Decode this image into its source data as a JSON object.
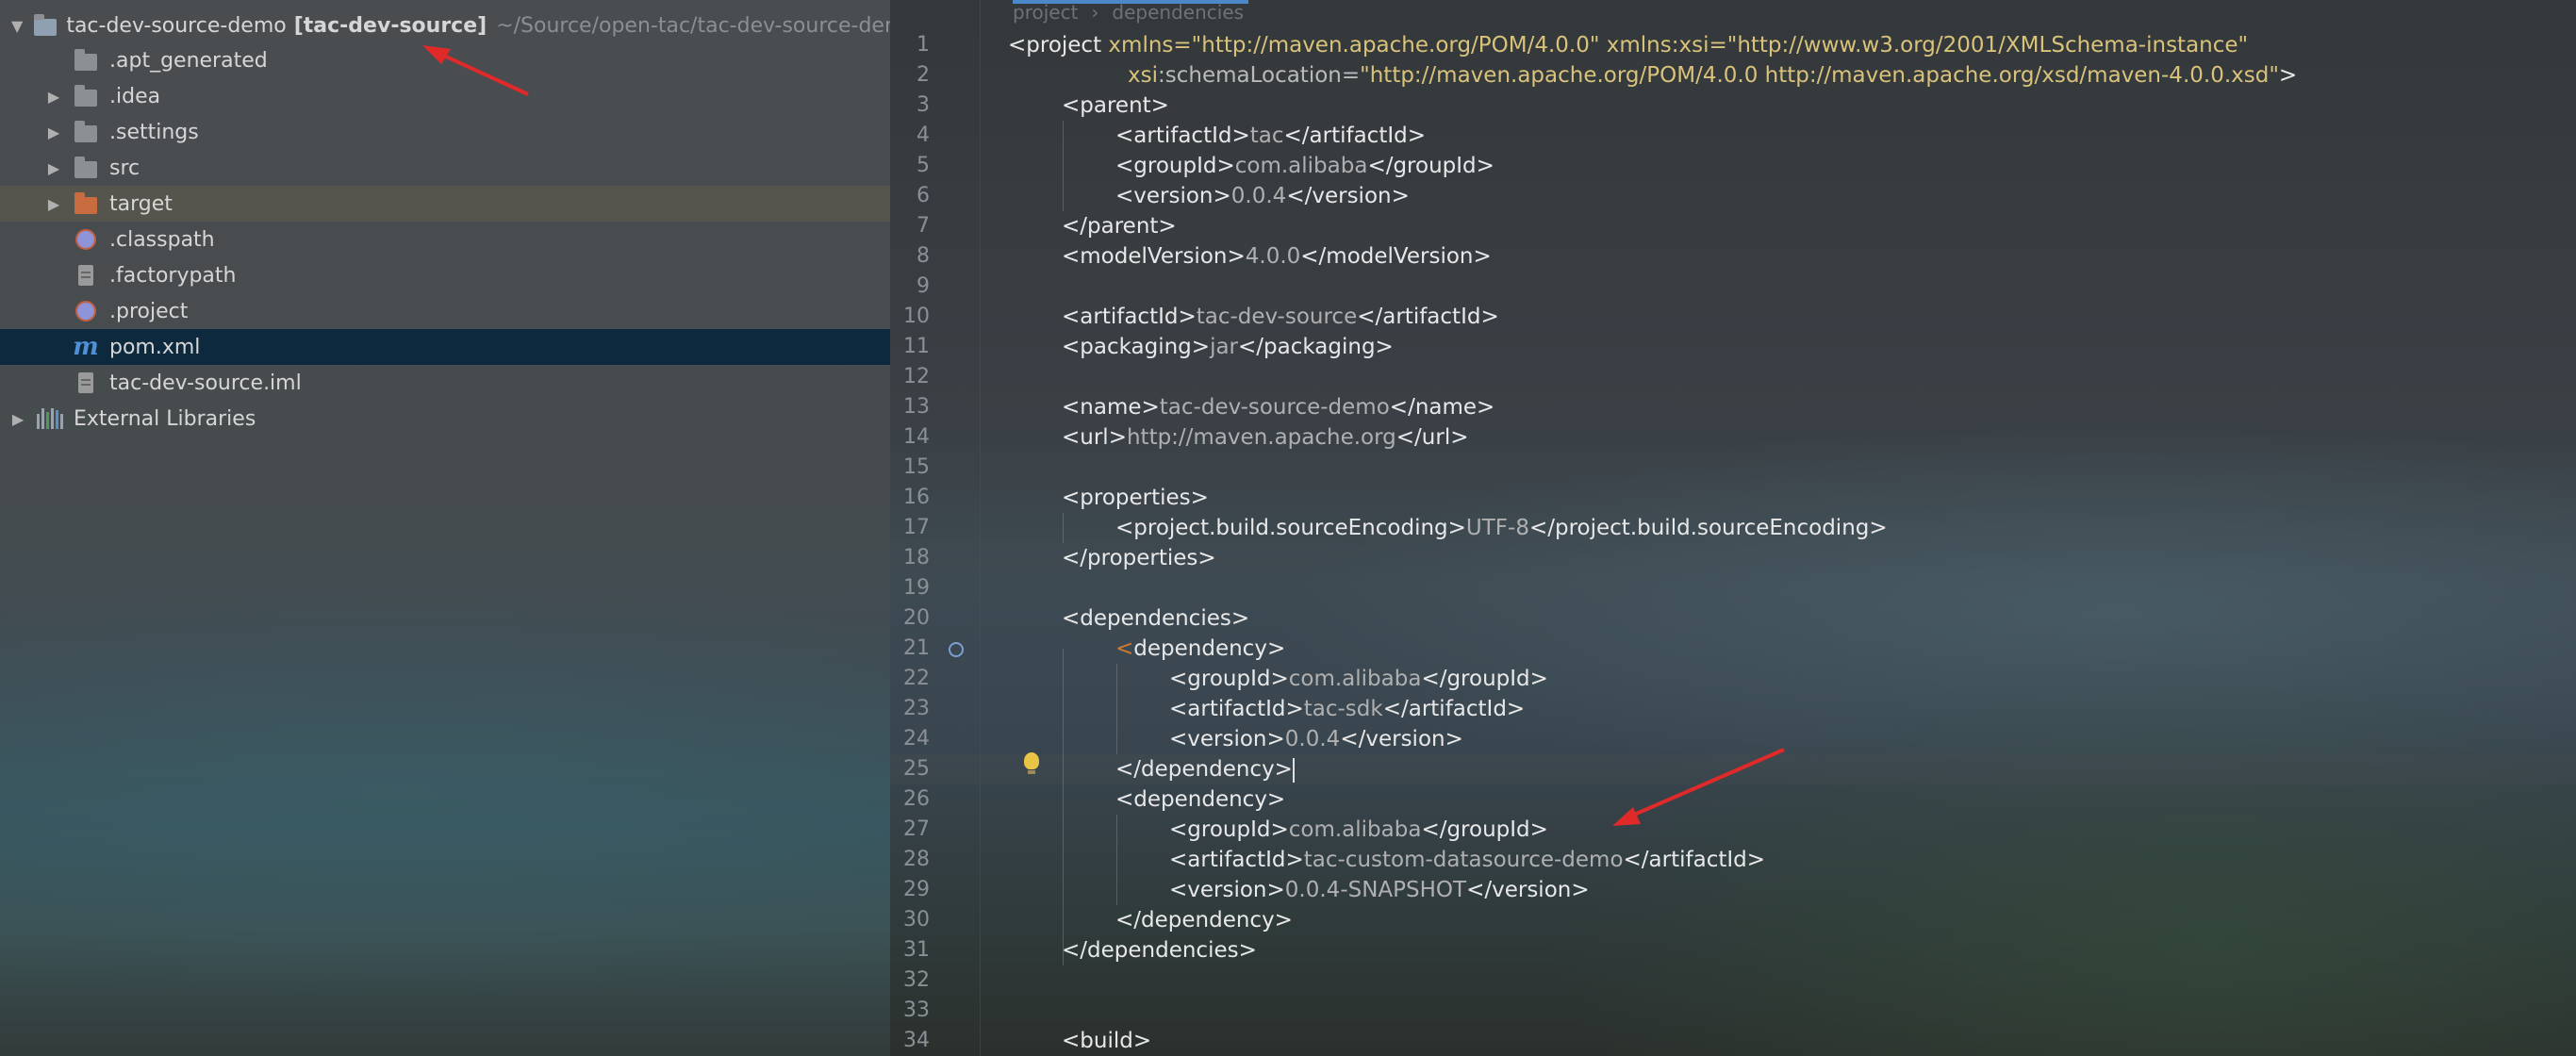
{
  "project_tree": {
    "root": {
      "name": "tac-dev-source-demo",
      "module": "[tac-dev-source]",
      "path": "~/Source/open-tac/tac-dev-source-demo"
    },
    "items": [
      {
        "label": ".apt_generated",
        "icon": "folder-icon"
      },
      {
        "label": ".idea",
        "icon": "folder-icon"
      },
      {
        "label": ".settings",
        "icon": "folder-icon"
      },
      {
        "label": "src",
        "icon": "folder-icon"
      },
      {
        "label": "target",
        "icon": "folder-orange-icon"
      },
      {
        "label": ".classpath",
        "icon": "classpath-icon"
      },
      {
        "label": ".factorypath",
        "icon": "file-icon"
      },
      {
        "label": ".project",
        "icon": "project-file-icon"
      },
      {
        "label": "pom.xml",
        "icon": "maven-icon"
      },
      {
        "label": "tac-dev-source.iml",
        "icon": "iml-file-icon"
      }
    ],
    "external_libraries": "External Libraries"
  },
  "breadcrumb": [
    "project",
    "dependencies"
  ],
  "editor": {
    "line_numbers": [
      "1",
      "2",
      "3",
      "4",
      "5",
      "6",
      "7",
      "8",
      "9",
      "10",
      "11",
      "12",
      "13",
      "14",
      "15",
      "16",
      "17",
      "18",
      "19",
      "20",
      "21",
      "22",
      "23",
      "24",
      "25",
      "26",
      "27",
      "28",
      "29",
      "30",
      "31",
      "32",
      "33",
      "34"
    ],
    "lines": {
      "l1_a": "<project ",
      "l1_b": "xmlns=\"http://maven.apache.org/POM/4.0.0\" xmlns:xsi=\"http://www.w3.org/2001/XMLSchema-instance\"",
      "l2_a": "xsi",
      "l2_b": ":schemaLocation=",
      "l2_c": "\"http://maven.apache.org/POM/4.0.0 http://maven.apache.org/xsd/maven-4.0.0.xsd\"",
      "l2_d": ">",
      "l3": "<parent>",
      "l4_a": "<artifactId>",
      "l4_b": "tac",
      "l4_c": "</artifactId>",
      "l5_a": "<groupId>",
      "l5_b": "com.alibaba",
      "l5_c": "</groupId>",
      "l6_a": "<version>",
      "l6_b": "0.0.4",
      "l6_c": "</version>",
      "l7": "</parent>",
      "l8_a": "<modelVersion>",
      "l8_b": "4.0.0",
      "l8_c": "</modelVersion>",
      "l10_a": "<artifactId>",
      "l10_b": "tac-dev-source",
      "l10_c": "</artifactId>",
      "l11_a": "<packaging>",
      "l11_b": "jar",
      "l11_c": "</packaging>",
      "l13_a": "<name>",
      "l13_b": "tac-dev-source-demo",
      "l13_c": "</name>",
      "l14_a": "<url>",
      "l14_b": "http://maven.apache.org",
      "l14_c": "</url>",
      "l16": "<properties>",
      "l17_a": "<project.build.sourceEncoding>",
      "l17_b": "UTF-8",
      "l17_c": "</project.build.sourceEncoding>",
      "l18": "</properties>",
      "l20": "<dependencies>",
      "l21_a": "<",
      "l21_b": "dependency>",
      "l22_a": "<groupId>",
      "l22_b": "com.alibaba",
      "l22_c": "</groupId>",
      "l23_a": "<artifactId>",
      "l23_b": "tac-sdk",
      "l23_c": "</artifactId>",
      "l24_a": "<version>",
      "l24_b": "0.0.4",
      "l24_c": "</version>",
      "l25": "</dependency>",
      "l26": "<dependency>",
      "l27_a": "<groupId>",
      "l27_b": "com.alibaba",
      "l27_c": "</groupId>",
      "l28_a": "<artifactId>",
      "l28_b": "tac-custom-datasource-demo",
      "l28_c": "</artifactId>",
      "l29_a": "<version>",
      "l29_b": "0.0.4-SNAPSHOT",
      "l29_c": "</version>",
      "l30": "</dependency>",
      "l31": "</dependencies>",
      "l34": "<build>"
    }
  },
  "colors": {
    "annotation_arrow": "#e02a2a",
    "selected_row": "#0d293e",
    "string_value": "#d9c27a",
    "tab_indicator": "#4a88c7"
  }
}
